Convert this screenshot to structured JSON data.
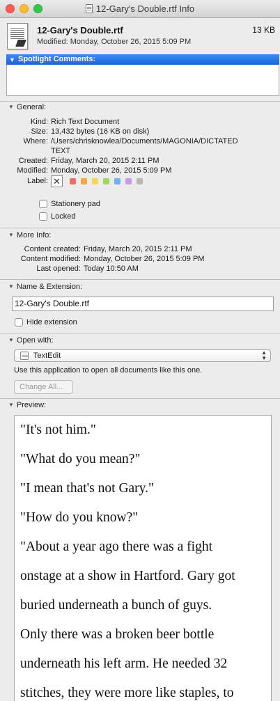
{
  "window": {
    "title": "12-Gary's Double.rtf Info"
  },
  "header": {
    "file_name": "12-Gary's Double.rtf",
    "file_size": "13 KB",
    "modified": "Modified: Monday, October 26, 2015 5:09 PM"
  },
  "spotlight": {
    "label": "Spotlight Comments:",
    "comment": ""
  },
  "general": {
    "label": "General:",
    "rows": [
      {
        "key": "Kind:",
        "value": "Rich Text Document"
      },
      {
        "key": "Size:",
        "value": "13,432 bytes (16 KB on disk)"
      },
      {
        "key": "Where:",
        "value": "/Users/chrisknowlea/Documents/MAGONIA/DICTATED",
        "value2": "TEXT"
      },
      {
        "key": "Created:",
        "value": "Friday, March 20, 2015 2:11 PM"
      },
      {
        "key": "Modified:",
        "value": "Monday, October 26, 2015 5:09 PM"
      }
    ],
    "label_key": "Label:",
    "label_none": "✕",
    "label_colors": [
      "#f26a6a",
      "#f5a742",
      "#f2d84c",
      "#9fd85a",
      "#6fb3f2",
      "#c99ae6",
      "#b8b8b8"
    ],
    "stationery_label": "Stationery pad",
    "stationery_checked": false,
    "locked_label": "Locked",
    "locked_checked": false
  },
  "more_info": {
    "label": "More Info:",
    "rows": [
      {
        "key": "Content created:",
        "value": "Friday, March 20, 2015 2:11 PM"
      },
      {
        "key": "Content modified:",
        "value": "Monday, October 26, 2015 5:09 PM"
      },
      {
        "key": "Last opened:",
        "value": "Today 10:50 AM"
      }
    ]
  },
  "name_ext": {
    "label": "Name & Extension:",
    "name_value": "12-Gary's Double.rtf",
    "hide_ext_label": "Hide extension",
    "hide_ext_checked": false
  },
  "open_with": {
    "label": "Open with:",
    "app": "TextEdit",
    "hint": "Use this application to open all documents like this one.",
    "change_all": "Change All..."
  },
  "preview": {
    "label": "Preview:",
    "lines": [
      "\"It's not him.\"",
      "\"What do you mean?\"",
      "\"I mean that's not Gary.\"",
      "\"How do you know?\"",
      "\"About a year ago there was a fight",
      "onstage at a show in Hartford. Gary got",
      "buried underneath a bunch of guys.",
      "Only there was a broken beer bottle",
      "underneath his left arm. He needed 32",
      "stitches, they were more like staples, to"
    ]
  }
}
